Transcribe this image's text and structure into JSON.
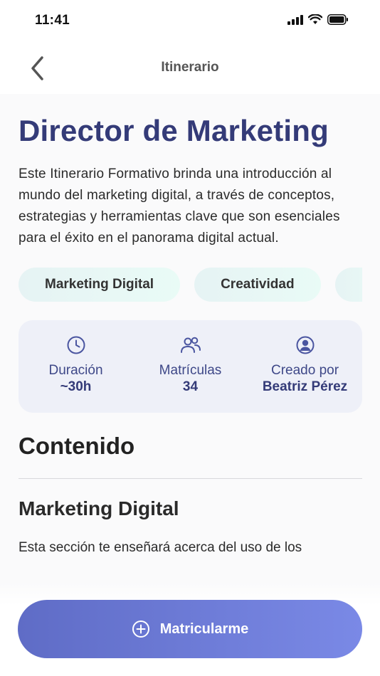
{
  "status_bar": {
    "time": "11:41"
  },
  "nav": {
    "title": "Itinerario"
  },
  "page": {
    "title": "Director de Marketing",
    "description": "Este Itinerario Formativo brinda una introducción al mundo del marketing digital, a través de conceptos, estrategias y herramientas clave que son esenciales para el éxito en el panorama digital actual."
  },
  "tags": [
    "Marketing Digital",
    "Creatividad",
    ""
  ],
  "stats": [
    {
      "icon": "clock-icon",
      "label": "Duración",
      "value": "~30h"
    },
    {
      "icon": "users-icon",
      "label": "Matrículas",
      "value": "34"
    },
    {
      "icon": "user-circle-icon",
      "label": "Creado por",
      "value": "Beatriz Pérez"
    }
  ],
  "content": {
    "section_title": "Contenido",
    "subsection_title": "Marketing Digital",
    "subsection_desc": "Esta sección te enseñará acerca del uso de los"
  },
  "cta": {
    "label": "Matricularme",
    "icon": "plus-circle-icon"
  },
  "colors": {
    "brand": "#343b78",
    "accent": "#6a79d8",
    "stats_bg": "#eef0f8"
  }
}
